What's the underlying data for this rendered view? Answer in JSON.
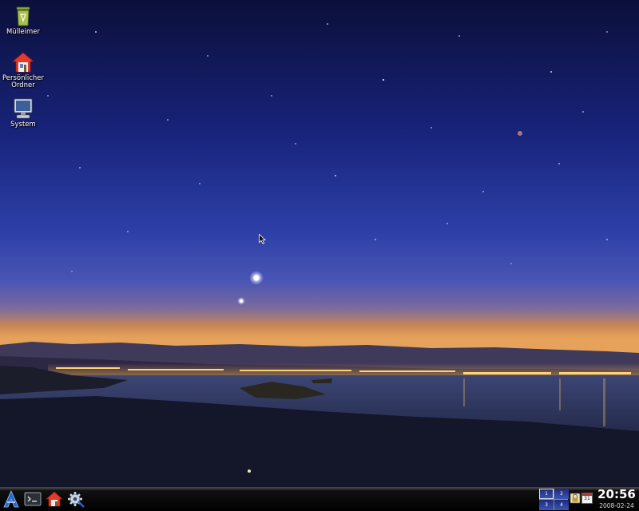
{
  "desktop": {
    "icons": [
      {
        "label": "Mülleimer",
        "icon": "trash-icon"
      },
      {
        "label": "Persönlicher Ordner",
        "icon": "home-folder-icon"
      },
      {
        "label": "System",
        "icon": "computer-icon"
      }
    ]
  },
  "panel": {
    "launchers": [
      {
        "icon": "start-menu-icon"
      },
      {
        "icon": "terminal-icon"
      },
      {
        "icon": "home-icon"
      },
      {
        "icon": "settings-icon"
      }
    ],
    "pager": {
      "workspaces": [
        "1",
        "2",
        "3",
        "4"
      ],
      "active": "1"
    },
    "tray": [
      {
        "icon": "lock-icon"
      },
      {
        "icon": "calendar-icon",
        "label": "31"
      }
    ],
    "clock": {
      "time": "20:56",
      "date": "2008-02-24"
    }
  },
  "colors": {
    "sky_top": "#0b0f3a",
    "sky_horizon": "#e08a3c",
    "panel": "#111111",
    "accent": "#2a66c8"
  }
}
